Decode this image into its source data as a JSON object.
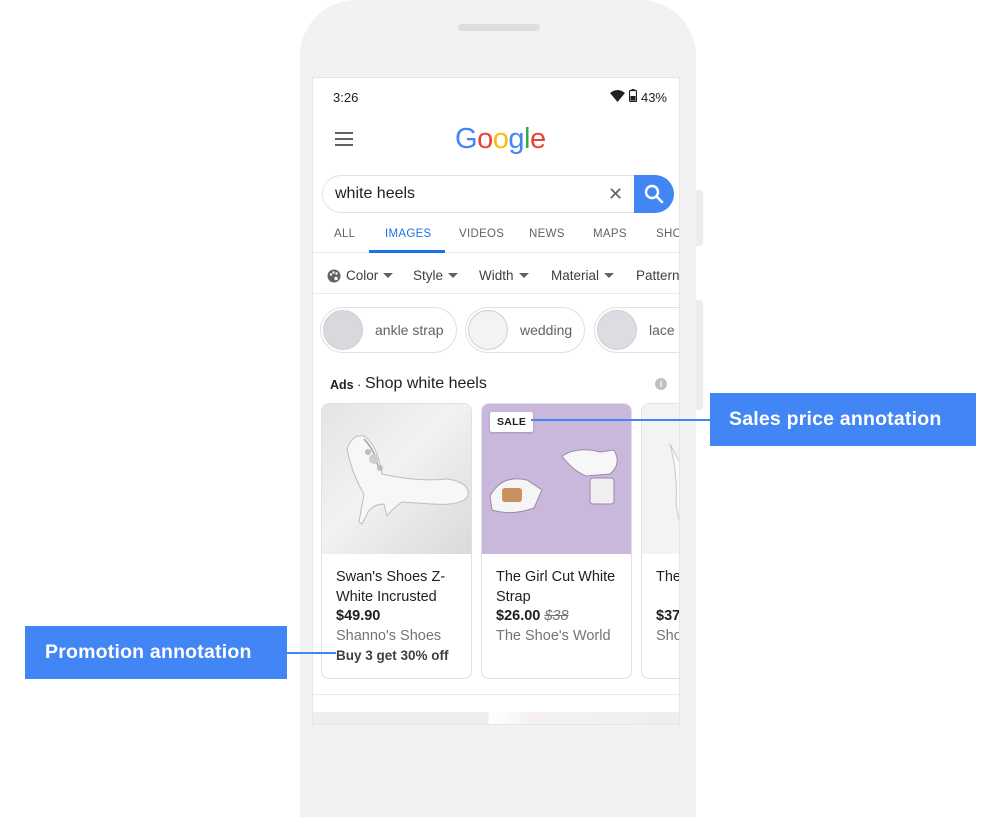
{
  "status_bar": {
    "time": "3:26",
    "battery": "43%"
  },
  "header": {
    "logo_letters": [
      {
        "char": "G",
        "color": "#4285F4"
      },
      {
        "char": "o",
        "color": "#EA4335"
      },
      {
        "char": "o",
        "color": "#FBBC05"
      },
      {
        "char": "g",
        "color": "#4285F4"
      },
      {
        "char": "l",
        "color": "#34A853"
      },
      {
        "char": "e",
        "color": "#EA4335"
      }
    ]
  },
  "search": {
    "value": "white heels"
  },
  "tabs": [
    {
      "label": "ALL",
      "active": false
    },
    {
      "label": "IMAGES",
      "active": true
    },
    {
      "label": "VIDEOS",
      "active": false
    },
    {
      "label": "NEWS",
      "active": false
    },
    {
      "label": "MAPS",
      "active": false
    },
    {
      "label": "SHO",
      "active": false
    }
  ],
  "filters": [
    "Color",
    "Style",
    "Width",
    "Material",
    "Pattern"
  ],
  "chips": [
    "ankle strap",
    "wedding",
    "lace"
  ],
  "ads": {
    "label": "Ads",
    "separator": "·",
    "title": "Shop white heels"
  },
  "products": [
    {
      "title": "Swan's Shoes Z-White Incrusted",
      "price": "$49.90",
      "merchant": "Shanno's Shoes",
      "promotion": "Buy 3 get 30% off"
    },
    {
      "badge": "SALE",
      "title": "The Girl Cut White Strap",
      "price": "$26.00",
      "original_price": "$38",
      "merchant": "The Shoe's World"
    },
    {
      "title": "The Emb",
      "price": "$37",
      "merchant": "Sho"
    }
  ],
  "annotations": {
    "sales_price": "Sales price annotation",
    "promotion": "Promotion annotation"
  },
  "colors": {
    "accent": "#4285F4",
    "active_tab": "#1A73E8",
    "sale_card_bg": "#C9B8DC"
  }
}
